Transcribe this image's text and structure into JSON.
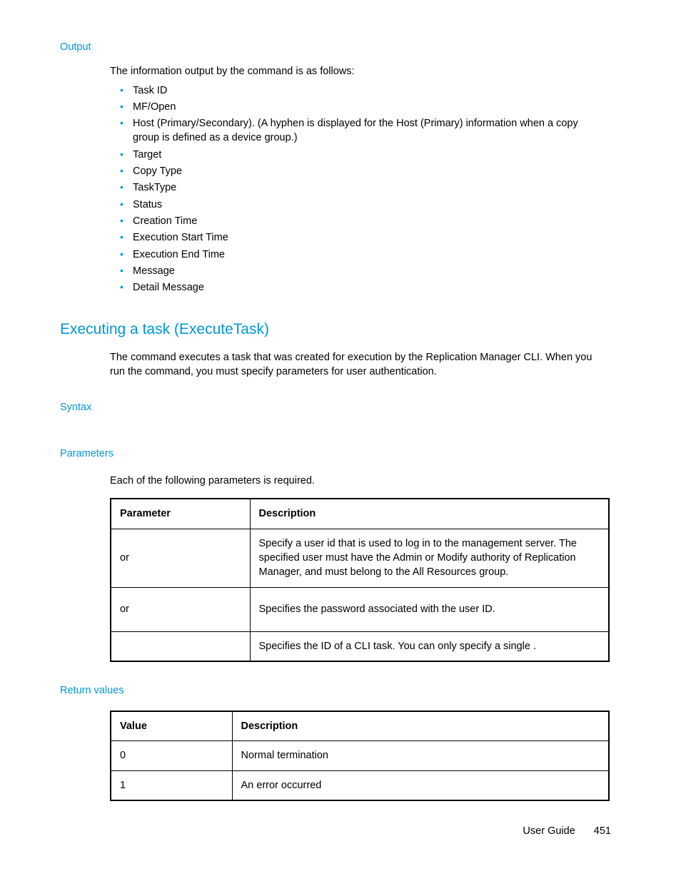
{
  "output": {
    "heading": "Output",
    "intro_prefix": "The information output by the ",
    "intro_suffix": " command is as follows:",
    "items": [
      "Task ID",
      "MF/Open",
      "Host (Primary/Secondary). (A hyphen is displayed for the Host (Primary) information when a copy group is defined as a device group.)",
      "Target",
      "Copy Type",
      "TaskType",
      "Status",
      "Creation Time",
      "Execution Start Time",
      "Execution End Time",
      "Message",
      "Detail Message"
    ]
  },
  "execute": {
    "heading": "Executing a task (ExecuteTask)",
    "para": "The                               command executes a task that was created for execution by the Replication Manager CLI. When you run the                              command, you must specify parameters for user authentication."
  },
  "syntax": {
    "heading": "Syntax"
  },
  "parameters": {
    "heading": "Parameters",
    "intro": "Each of the following parameters is required.",
    "col1": "Parameter",
    "col2": "Description",
    "rows": [
      {
        "param": "or",
        "desc": "Specify a user id that is used to log in to the management server. The specified user must have the Admin or Modify authority of Replication Manager, and must belong to the All Resources group."
      },
      {
        "param": "or",
        "desc": "Specifies the password associated with the user ID."
      },
      {
        "param": "",
        "desc": "Specifies the ID of a CLI task. You can only specify a single                    ."
      }
    ]
  },
  "return_values": {
    "heading": "Return values",
    "col1": "Value",
    "col2": "Description",
    "rows": [
      {
        "value": "0",
        "desc": "Normal termination"
      },
      {
        "value": "1",
        "desc": "An error occurred"
      }
    ]
  },
  "footer": {
    "label": "User Guide",
    "page": "451"
  }
}
